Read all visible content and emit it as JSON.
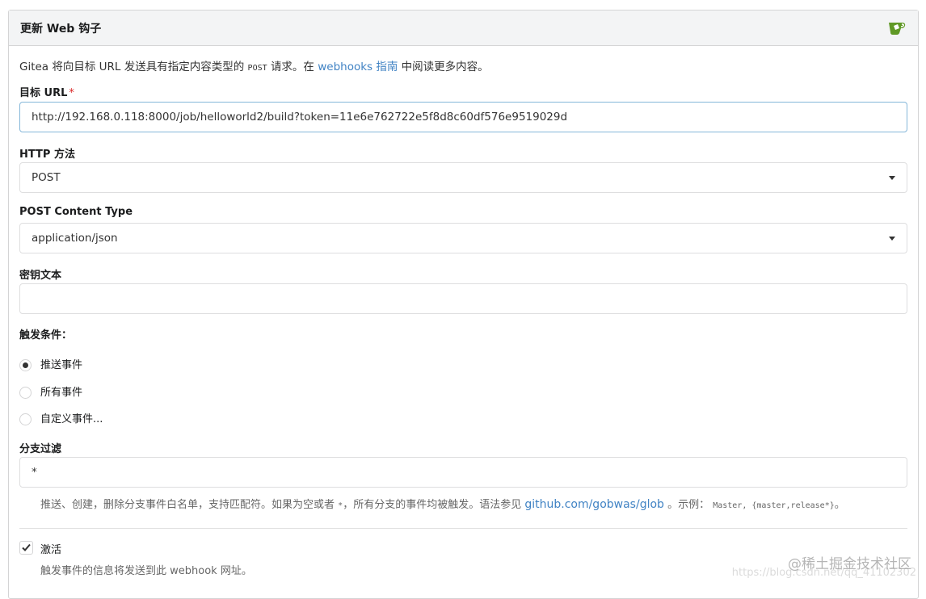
{
  "panel": {
    "title": "更新 Web 钩子"
  },
  "description": {
    "prefix": "Gitea 将向目标 URL 发送具有指定内容类型的",
    "method": "POST",
    "middle": "请求。在",
    "link": "webhooks 指南",
    "suffix": "中阅读更多内容。"
  },
  "target_url": {
    "label": "目标 URL",
    "required_mark": "*",
    "value": "http://192.168.0.118:8000/job/helloworld2/build?token=11e6e762722e5f8d8c60df576e9519029d"
  },
  "http_method": {
    "label": "HTTP 方法",
    "selected": "POST"
  },
  "content_type": {
    "label": "POST Content Type",
    "selected": "application/json"
  },
  "secret": {
    "label": "密钥文本",
    "value": ""
  },
  "trigger": {
    "label": "触发条件：",
    "options": [
      {
        "label": "推送事件",
        "checked": true
      },
      {
        "label": "所有事件",
        "checked": false
      },
      {
        "label": "自定义事件...",
        "checked": false
      }
    ]
  },
  "branch_filter": {
    "label": "分支过滤",
    "value": "*",
    "help_prefix": "推送、创建，删除分支事件白名单，支持匹配符。如果为空或者",
    "help_star": "*",
    "help_mid": "，所有分支的事件均被触发。语法参见",
    "help_link": "github.com/gobwas/glob",
    "help_example_prefix": "。示例：",
    "help_example": "Master, {master,release*}",
    "help_end": "。"
  },
  "active": {
    "label": "激活",
    "checked": true,
    "help": "触发事件的信息将发送到此 webhook 网址。"
  },
  "watermark": {
    "main": "@稀土掘金技术社区",
    "sub": "https://blog.csdn.net/qq_41102302"
  },
  "colors": {
    "link": "#4183c4",
    "required": "#db2828",
    "gitea_green": "#609926"
  }
}
